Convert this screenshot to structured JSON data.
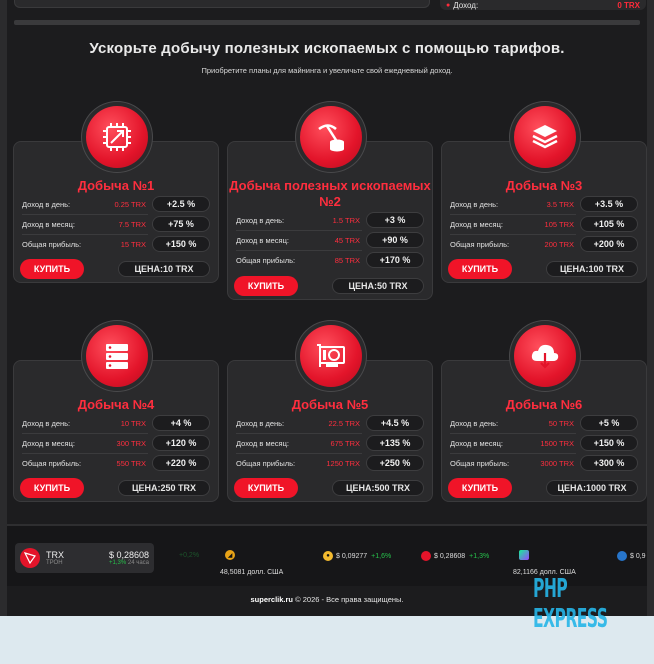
{
  "top": {
    "income_label": "Доход:",
    "income_value": "0 TRX"
  },
  "hero": {
    "title": "Ускорьте добычу полезных ископаемых с помощью тарифов.",
    "subtitle": "Приобретите планы для майнинга и увеличьте свой ежедневный доход."
  },
  "labels": {
    "per_day": "Доход в день:",
    "per_month": "Доход в месяц:",
    "total": "Общая прибыль:",
    "buy": "КУПИТЬ"
  },
  "plans": [
    {
      "title": "Добыча №1",
      "icon": "cpu-chip-icon",
      "day": "0.25 TRX",
      "day_pct": "+2.5 %",
      "month": "7.5 TRX",
      "month_pct": "+75 %",
      "total": "15 TRX",
      "total_pct": "+150 %",
      "price": "ЦЕНА:10 TRX"
    },
    {
      "title": "Добыча полезных ископаемых №2",
      "icon": "pickaxe-coins-icon",
      "day": "1.5 TRX",
      "day_pct": "+3 %",
      "month": "45 TRX",
      "month_pct": "+90 %",
      "total": "85 TRX",
      "total_pct": "+170 %",
      "price": "ЦЕНА:50 TRX"
    },
    {
      "title": "Добыча №3",
      "icon": "layers-stack-icon",
      "day": "3.5 TRX",
      "day_pct": "+3.5 %",
      "month": "105 TRX",
      "month_pct": "+105 %",
      "total": "200 TRX",
      "total_pct": "+200 %",
      "price": "ЦЕНА:100 TRX"
    },
    {
      "title": "Добыча №4",
      "icon": "server-rack-icon",
      "day": "10 TRX",
      "day_pct": "+4 %",
      "month": "300 TRX",
      "month_pct": "+120 %",
      "total": "550 TRX",
      "total_pct": "+220 %",
      "price": "ЦЕНА:250 TRX"
    },
    {
      "title": "Добыча №5",
      "icon": "graphics-card-icon",
      "day": "22.5 TRX",
      "day_pct": "+4.5 %",
      "month": "675 TRX",
      "month_pct": "+135 %",
      "total": "1250 TRX",
      "total_pct": "+250 %",
      "price": "ЦЕНА:500 TRX"
    },
    {
      "title": "Добыча №6",
      "icon": "cloud-mining-icon",
      "day": "50 TRX",
      "day_pct": "+5 %",
      "month": "1500 TRX",
      "month_pct": "+150 %",
      "total": "3000 TRX",
      "total_pct": "+300 %",
      "price": "ЦЕНА:1000 TRX"
    }
  ],
  "ticker": {
    "trx": {
      "symbol": "TRX",
      "name": "ТРОН",
      "price": "$ 0,28608",
      "change": "+1,3%",
      "period": "24 часа"
    },
    "faded_change": "+0,2%",
    "item1_sub": "48,5081 долл. США",
    "item2_price": "$ 0,09277",
    "item2_change": "+1,6%",
    "item3_price": "$ 0,28608",
    "item3_change": "+1,3%",
    "item4_sub": "82,1166 долл. США",
    "item5_price": "$ 0,9"
  },
  "footer": {
    "site": "superclik.ru",
    "rest": "© 2026 - Все права защищены."
  },
  "watermark": "PHP EXPRESS",
  "colors": {
    "accent": "#f01428",
    "bg": "#1c1c1e",
    "card": "#2a2a2c",
    "positive": "#27c24c"
  }
}
